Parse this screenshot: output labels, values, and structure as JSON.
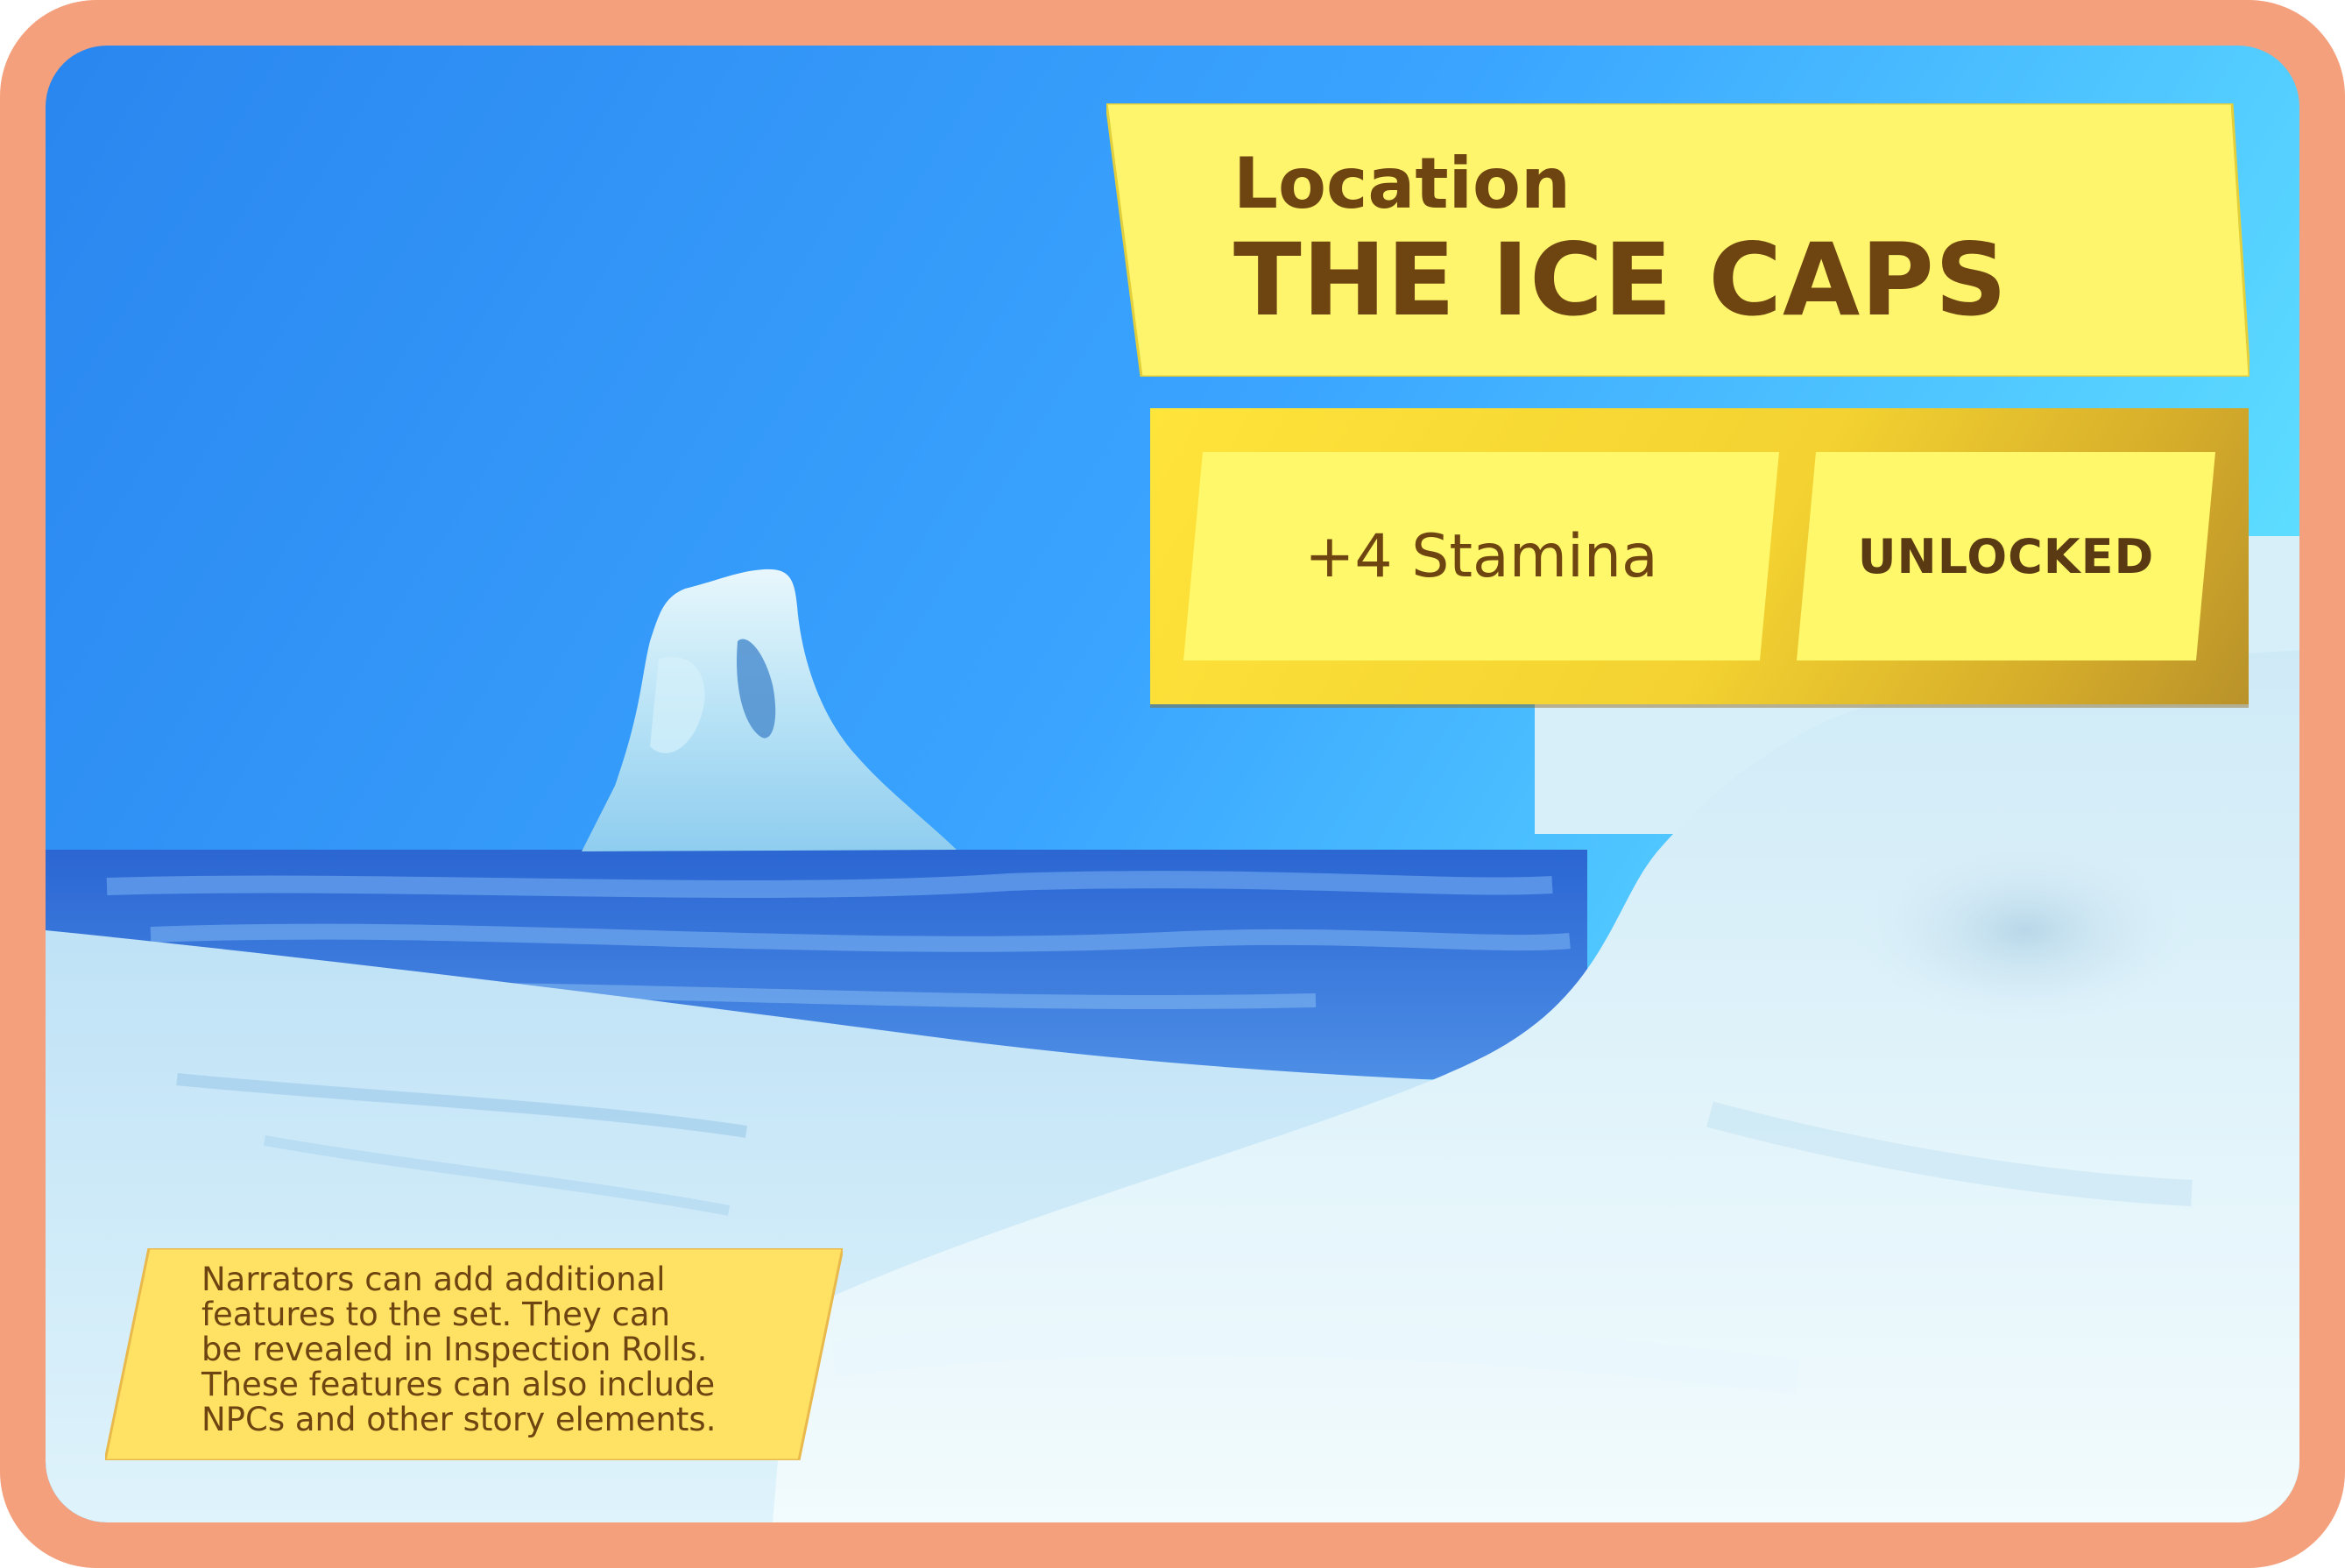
{
  "card": {
    "kind_label": "Location",
    "name": "THE ICE CAPS",
    "stat_bonus": "+4 Stamina",
    "status": "UNLOCKED",
    "narrator_note": "Narrators can add additional\nfeatures to the set. They can\nbe revealed in Inspection Rolls.\nThese features can also include\nNPCs and other story elements."
  },
  "scene": {
    "subject": "iceberg-and-snowfield",
    "colors": {
      "frame": "#f4a07c",
      "sky_top": "#2f8ff2",
      "sky_right": "#5fdcff",
      "sea": "#2f6fd6",
      "snow": "#e6f6fb",
      "banner": "#fff46a",
      "banner_text": "#6e4410"
    }
  }
}
